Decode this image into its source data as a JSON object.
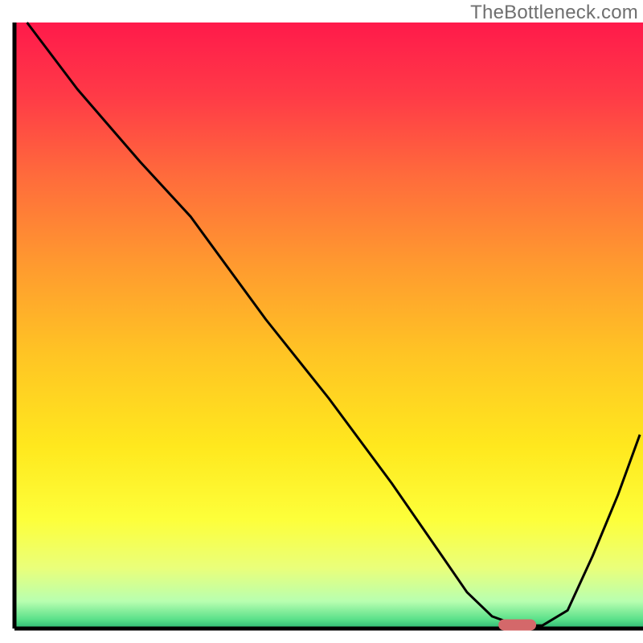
{
  "attribution": "TheBottleneck.com",
  "chart_data": {
    "type": "line",
    "title": "",
    "xlabel": "",
    "ylabel": "",
    "xlim": [
      0,
      100
    ],
    "ylim": [
      0,
      100
    ],
    "x": [
      2,
      10,
      20,
      28,
      40,
      50,
      60,
      68,
      72,
      76,
      80,
      84,
      88,
      92,
      96,
      99.5
    ],
    "values": [
      100,
      89,
      77,
      68,
      51,
      38,
      24,
      12,
      6,
      2,
      0.5,
      0.5,
      3,
      12,
      22,
      32
    ],
    "optimum_marker": {
      "x_start": 77,
      "x_end": 83,
      "y": 0.6,
      "color": "#d4686a"
    },
    "gradient_stops": [
      {
        "offset": 0.0,
        "color": "#ff1a4b"
      },
      {
        "offset": 0.12,
        "color": "#ff3a47"
      },
      {
        "offset": 0.25,
        "color": "#ff6a3c"
      },
      {
        "offset": 0.4,
        "color": "#ff9a2f"
      },
      {
        "offset": 0.55,
        "color": "#ffc524"
      },
      {
        "offset": 0.7,
        "color": "#ffe81e"
      },
      {
        "offset": 0.82,
        "color": "#fdff3a"
      },
      {
        "offset": 0.9,
        "color": "#eaff7a"
      },
      {
        "offset": 0.955,
        "color": "#b8ffb0"
      },
      {
        "offset": 0.985,
        "color": "#5ae08a"
      },
      {
        "offset": 1.0,
        "color": "#2bb673"
      }
    ],
    "axis_color": "#000000",
    "line_color": "#000000",
    "line_width": 3
  }
}
